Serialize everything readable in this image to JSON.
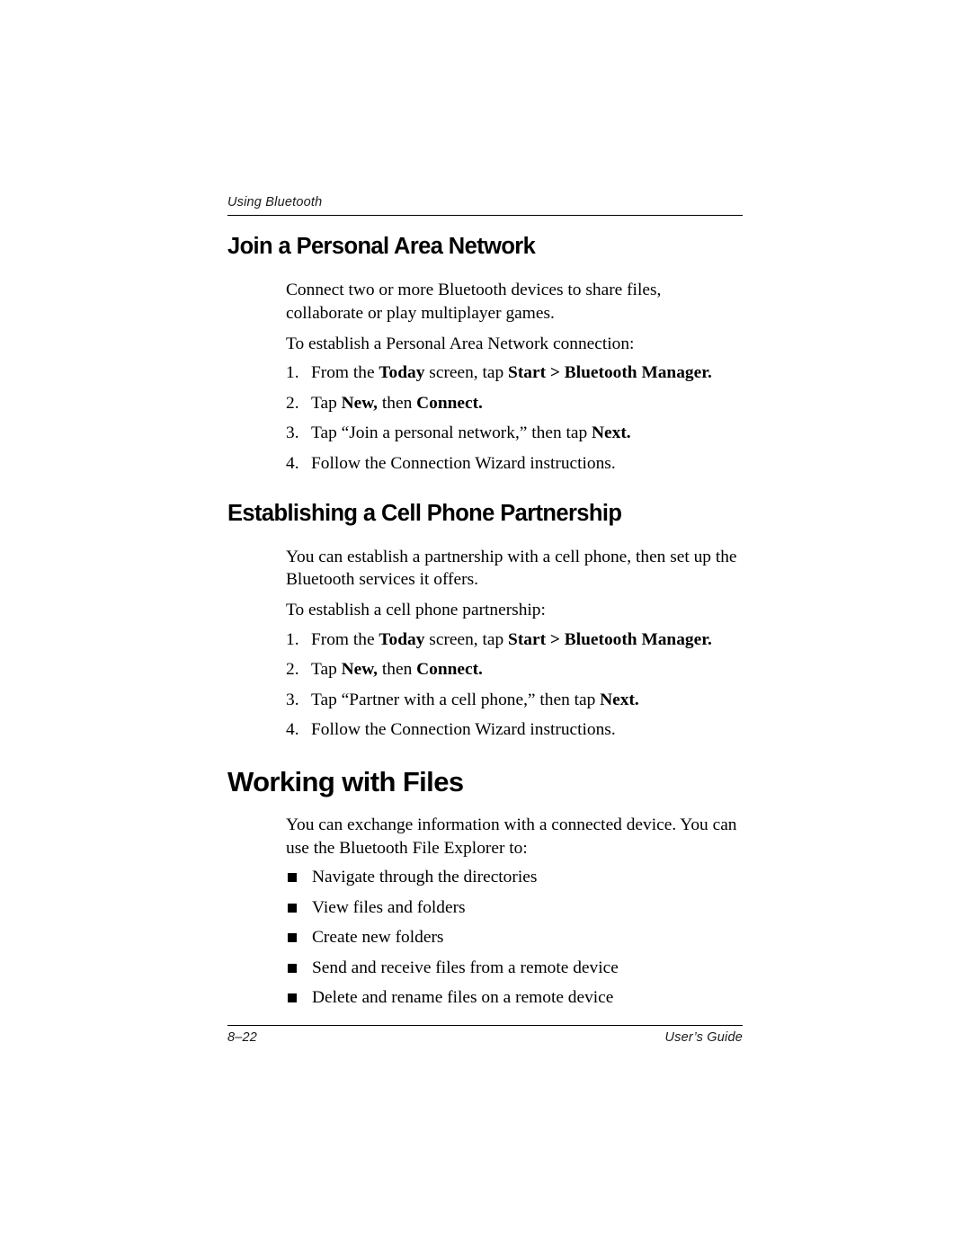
{
  "running_header": {
    "text": "Using Bluetooth"
  },
  "sections": [
    {
      "heading": "Join a Personal Area Network",
      "heading_level": 2,
      "paragraphs": [
        "Connect two or more Bluetooth devices to share files, collaborate or play multiplayer games.",
        "To establish a Personal Area Network connection:"
      ],
      "steps": [
        {
          "number": "1.",
          "parts": [
            {
              "text": "From the ",
              "bold": false
            },
            {
              "text": "Today",
              "bold": true
            },
            {
              "text": " screen, tap ",
              "bold": false
            },
            {
              "text": "Start > Bluetooth Manager.",
              "bold": true
            }
          ]
        },
        {
          "number": "2.",
          "parts": [
            {
              "text": "Tap ",
              "bold": false
            },
            {
              "text": "New,",
              "bold": true
            },
            {
              "text": " then ",
              "bold": false
            },
            {
              "text": "Connect.",
              "bold": true
            }
          ]
        },
        {
          "number": "3.",
          "parts": [
            {
              "text": "Tap “Join a personal network,” then tap ",
              "bold": false
            },
            {
              "text": "Next.",
              "bold": true
            }
          ]
        },
        {
          "number": "4.",
          "parts": [
            {
              "text": "Follow the Connection Wizard instructions.",
              "bold": false
            }
          ]
        }
      ]
    },
    {
      "heading": "Establishing a Cell Phone Partnership",
      "heading_level": 2,
      "paragraphs": [
        "You can establish a partnership with a cell phone, then set up the Bluetooth services it offers.",
        "To establish a cell phone partnership:"
      ],
      "steps": [
        {
          "number": "1.",
          "parts": [
            {
              "text": "From the ",
              "bold": false
            },
            {
              "text": "Today",
              "bold": true
            },
            {
              "text": " screen, tap ",
              "bold": false
            },
            {
              "text": "Start > Bluetooth Manager.",
              "bold": true
            }
          ]
        },
        {
          "number": "2.",
          "parts": [
            {
              "text": "Tap ",
              "bold": false
            },
            {
              "text": "New,",
              "bold": true
            },
            {
              "text": " then ",
              "bold": false
            },
            {
              "text": "Connect.",
              "bold": true
            }
          ]
        },
        {
          "number": "3.",
          "parts": [
            {
              "text": "Tap “Partner with a cell phone,” then tap ",
              "bold": false
            },
            {
              "text": "Next.",
              "bold": true
            }
          ]
        },
        {
          "number": "4.",
          "parts": [
            {
              "text": "Follow the Connection Wizard instructions.",
              "bold": false
            }
          ]
        }
      ]
    },
    {
      "heading": "Working with Files",
      "heading_level": 1,
      "paragraphs": [
        "You can exchange information with a connected device. You can use the Bluetooth File Explorer to:"
      ],
      "bullets": [
        "Navigate through the directories",
        "View files and folders",
        "Create new folders",
        "Send and receive files from a remote device",
        "Delete and rename files on a remote device"
      ]
    }
  ],
  "footer": {
    "page_number": "8–22",
    "doc_label": "User’s Guide"
  },
  "colors": {
    "text": "#000000",
    "rule": "#000000",
    "background": "#ffffff"
  }
}
